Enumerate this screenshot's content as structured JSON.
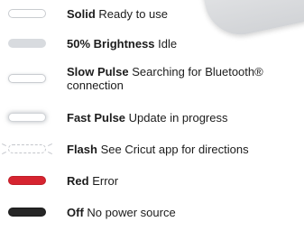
{
  "legend": {
    "items": [
      {
        "title": "Solid",
        "description": "Ready to use",
        "swatch_color": "#ffffff",
        "swatch_style": "outlined"
      },
      {
        "title": "50% Brightness",
        "description": "Idle",
        "swatch_color": "#d8dbdf",
        "swatch_style": "filled"
      },
      {
        "title": "Slow Pulse",
        "description": "Searching for Bluetooth® connection",
        "swatch_color": "#ffffff",
        "swatch_style": "soft-glow"
      },
      {
        "title": "Fast Pulse",
        "description": "Update in progress",
        "swatch_color": "#ffffff",
        "swatch_style": "strong-glow"
      },
      {
        "title": "Flash",
        "description": "See Cricut app for directions",
        "swatch_color": "#ffffff",
        "swatch_style": "dashed-with-rays"
      },
      {
        "title": "Red",
        "description": "Error",
        "swatch_color": "#d62430",
        "swatch_style": "filled"
      },
      {
        "title": "Off",
        "description": "No power source",
        "swatch_color": "#262626",
        "swatch_style": "filled"
      }
    ]
  }
}
